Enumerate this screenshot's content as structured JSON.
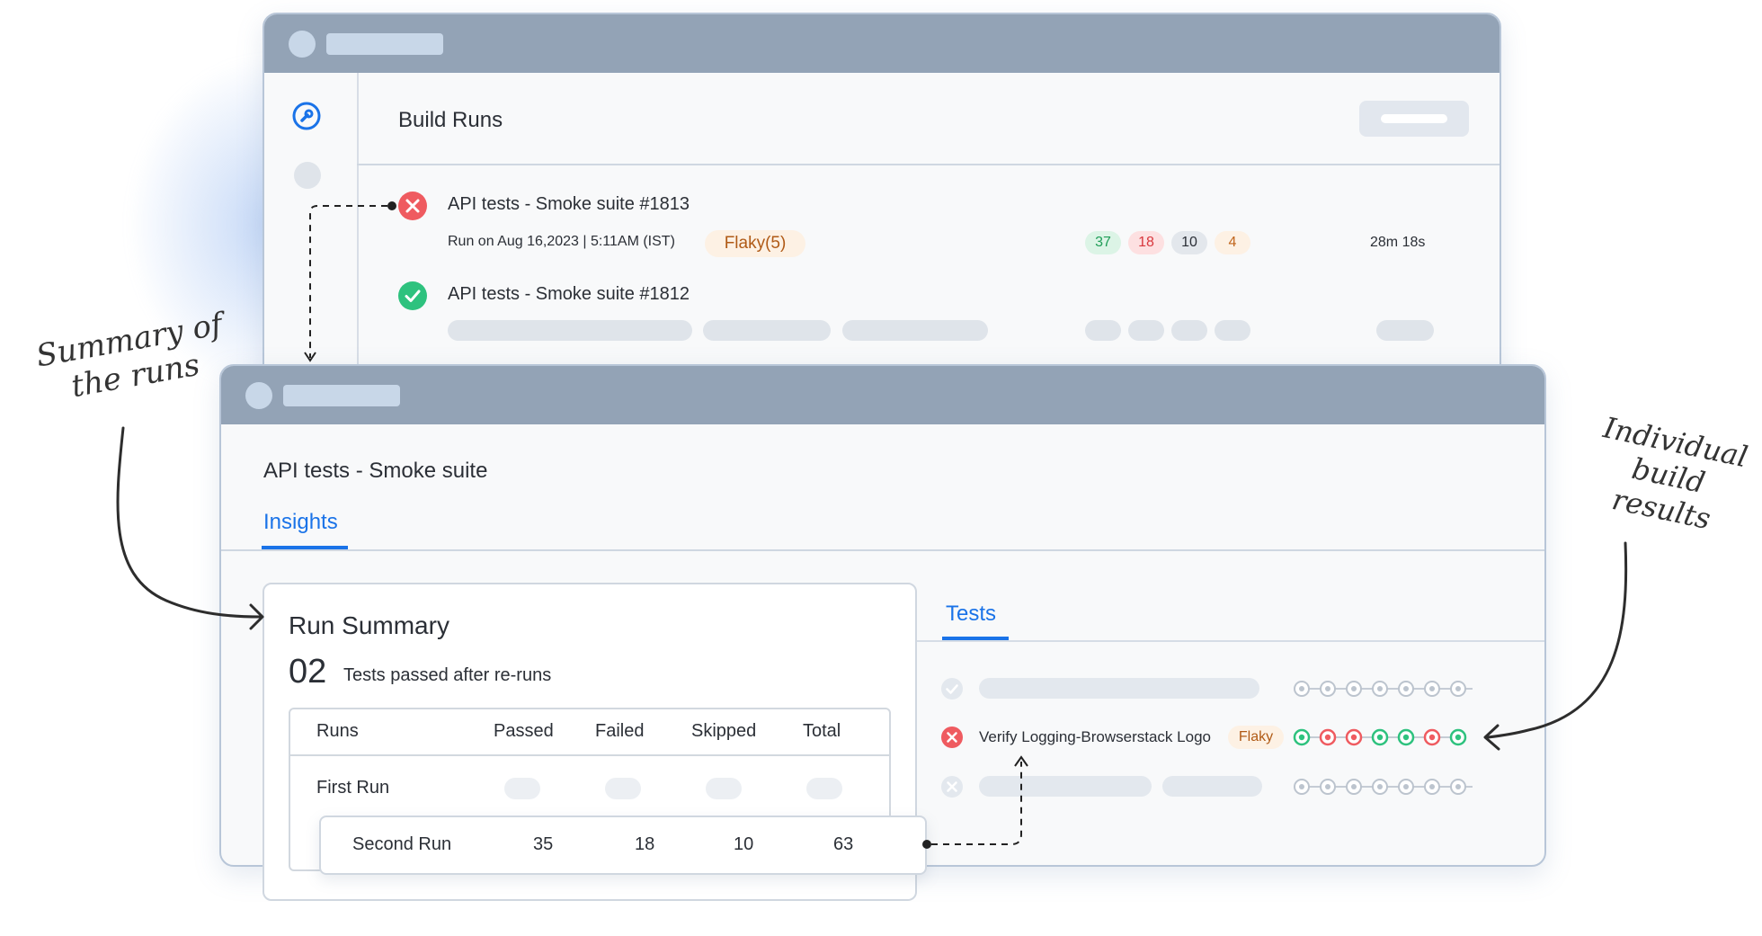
{
  "build_runs": {
    "title": "Build Runs",
    "runs": [
      {
        "name": "API tests - Smoke suite #1813",
        "status": "failed",
        "meta": "Run on Aug 16,2023 | 5:11AM (IST)",
        "flaky_badge": "Flaky(5)",
        "counts": [
          "37",
          "18",
          "10",
          "4"
        ],
        "duration": "28m 18s"
      },
      {
        "name": "API tests - Smoke suite #1812",
        "status": "passed"
      }
    ]
  },
  "suite": {
    "title": "API tests - Smoke suite",
    "tab": "Insights"
  },
  "run_summary": {
    "title": "Run Summary",
    "count": "02",
    "count_label": "Tests passed after re-runs",
    "columns": [
      "Runs",
      "Passed",
      "Failed",
      "Skipped",
      "Total"
    ],
    "rows": [
      {
        "label": "First Run"
      },
      {
        "label": "Second Run",
        "values": [
          "35",
          "18",
          "10",
          "63"
        ]
      }
    ]
  },
  "tests": {
    "tab": "Tests",
    "items": [
      {
        "name": "Verify Logging-Browserstack Logo",
        "badge": "Flaky",
        "history": [
          "passed",
          "failed",
          "failed",
          "passed",
          "passed",
          "failed",
          "passed"
        ]
      }
    ]
  },
  "annotations": {
    "left": [
      "Summary of",
      "the runs"
    ],
    "right": [
      "Individual",
      "build",
      "results"
    ]
  },
  "colors": {
    "pass": "#2ec27e",
    "fail": "#ef5b60",
    "accent": "#1a73e8",
    "titlebar": "#93a3b6"
  }
}
